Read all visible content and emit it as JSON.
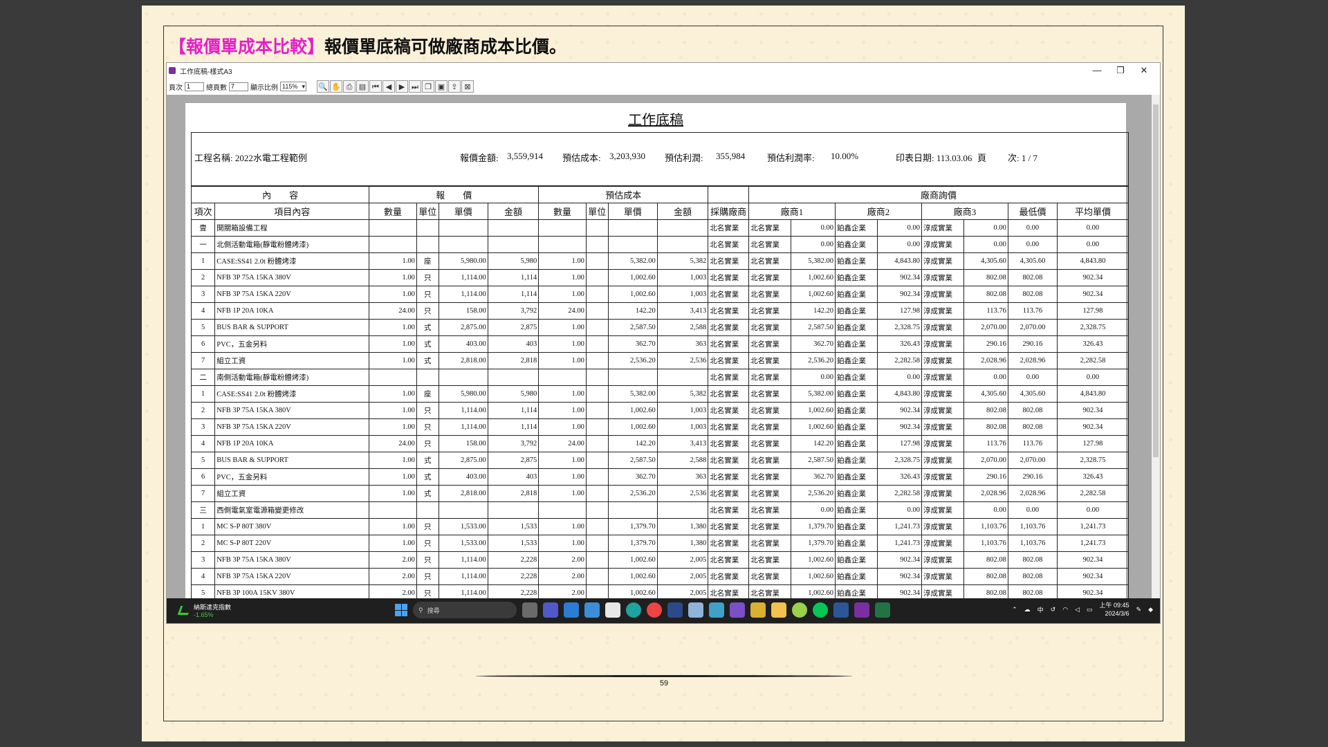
{
  "slide": {
    "heading_bracket": "【報價單成本比較】",
    "heading_text": "報價單底稿可做廠商成本比價。",
    "page_number": "59"
  },
  "window": {
    "title": "工作底稿-樣式A3",
    "minimize": "—",
    "restore": "❐",
    "close": "✕",
    "toolbar": {
      "page_label": "頁次",
      "page_value": "1",
      "total_label": "總頁數",
      "total_value": "7",
      "zoom_label": "顯示比例",
      "zoom_value": "115%"
    }
  },
  "report": {
    "title": "工作底稿",
    "project_name": "工程名稱: 2022水電工程範例",
    "quote_label": "報價金額:",
    "quote_value": "3,559,914",
    "cost_label": "預估成本:",
    "cost_value": "3,203,930",
    "profit_label": "預估利潤:",
    "profit_value": "355,984",
    "rate_label": "預估利潤率:",
    "rate_value": "10.00%",
    "print_date": "印表日期: 113.03.06",
    "page_label": "頁",
    "page_info": "次:  1  /  7",
    "group_headers": {
      "content": "內　　容",
      "quote": "報　　價",
      "cost": "預估成本",
      "vendor": "廠商詢價"
    },
    "columns": [
      "項次",
      "項目內容",
      "數量",
      "單位",
      "單價",
      "金額",
      "數量",
      "單位",
      "單價",
      "金額",
      "採購廠商",
      "廠商1",
      "廠商2",
      "廠商3",
      "最低價",
      "平均單價"
    ],
    "rows": [
      [
        "壹",
        "開關箱設備工程",
        "",
        "",
        "",
        "",
        "",
        "",
        "",
        "",
        "北名實業",
        "北名實業",
        "0.00",
        "鉑鑫企業",
        "0.00",
        "淳成實業",
        "0.00",
        "0.00",
        "0.00"
      ],
      [
        "一",
        "北側活動電箱(靜電粉體烤漆)",
        "",
        "",
        "",
        "",
        "",
        "",
        "",
        "",
        "北名實業",
        "北名實業",
        "0.00",
        "鉑鑫企業",
        "0.00",
        "淳成實業",
        "0.00",
        "0.00",
        "0.00"
      ],
      [
        "1",
        "CASE:SS41 2.0t 粉體烤漆",
        "1.00",
        "座",
        "5,980.00",
        "5,980",
        "1.00",
        "",
        "5,382.00",
        "5,382",
        "北名實業",
        "北名實業",
        "5,382.00",
        "鉑鑫企業",
        "4,843.80",
        "淳成實業",
        "4,305.60",
        "4,305.60",
        "4,843.80"
      ],
      [
        "2",
        "NFB 3P 75A 15KA 380V",
        "1.00",
        "只",
        "1,114.00",
        "1,114",
        "1.00",
        "",
        "1,002.60",
        "1,003",
        "北名實業",
        "北名實業",
        "1,002.60",
        "鉑鑫企業",
        "902.34",
        "淳成實業",
        "802.08",
        "802.08",
        "902.34"
      ],
      [
        "3",
        "NFB 3P 75A 15KA 220V",
        "1.00",
        "只",
        "1,114.00",
        "1,114",
        "1.00",
        "",
        "1,002.60",
        "1,003",
        "北名實業",
        "北名實業",
        "1,002.60",
        "鉑鑫企業",
        "902.34",
        "淳成實業",
        "802.08",
        "802.08",
        "902.34"
      ],
      [
        "4",
        "NFB 1P 20A 10KA",
        "24.00",
        "只",
        "158.00",
        "3,792",
        "24.00",
        "",
        "142.20",
        "3,413",
        "北名實業",
        "北名實業",
        "142.20",
        "鉑鑫企業",
        "127.98",
        "淳成實業",
        "113.76",
        "113.76",
        "127.98"
      ],
      [
        "5",
        "BUS BAR & SUPPORT",
        "1.00",
        "式",
        "2,875.00",
        "2,875",
        "1.00",
        "",
        "2,587.50",
        "2,588",
        "北名實業",
        "北名實業",
        "2,587.50",
        "鉑鑫企業",
        "2,328.75",
        "淳成實業",
        "2,070.00",
        "2,070.00",
        "2,328.75"
      ],
      [
        "6",
        "PVC，五金另料",
        "1.00",
        "式",
        "403.00",
        "403",
        "1.00",
        "",
        "362.70",
        "363",
        "北名實業",
        "北名實業",
        "362.70",
        "鉑鑫企業",
        "326.43",
        "淳成實業",
        "290.16",
        "290.16",
        "326.43"
      ],
      [
        "7",
        "組立工資",
        "1.00",
        "式",
        "2,818.00",
        "2,818",
        "1.00",
        "",
        "2,536.20",
        "2,536",
        "北名實業",
        "北名實業",
        "2,536.20",
        "鉑鑫企業",
        "2,282.58",
        "淳成實業",
        "2,028.96",
        "2,028.96",
        "2,282.58"
      ],
      [
        "二",
        "南側活動電箱(靜電粉體烤漆)",
        "",
        "",
        "",
        "",
        "",
        "",
        "",
        "",
        "北名實業",
        "北名實業",
        "0.00",
        "鉑鑫企業",
        "0.00",
        "淳成實業",
        "0.00",
        "0.00",
        "0.00"
      ],
      [
        "1",
        "CASE:SS41 2.0t 粉體烤漆",
        "1.00",
        "座",
        "5,980.00",
        "5,980",
        "1.00",
        "",
        "5,382.00",
        "5,382",
        "北名實業",
        "北名實業",
        "5,382.00",
        "鉑鑫企業",
        "4,843.80",
        "淳成實業",
        "4,305.60",
        "4,305.60",
        "4,843.80"
      ],
      [
        "2",
        "NFB 3P 75A 15KA 380V",
        "1.00",
        "只",
        "1,114.00",
        "1,114",
        "1.00",
        "",
        "1,002.60",
        "1,003",
        "北名實業",
        "北名實業",
        "1,002.60",
        "鉑鑫企業",
        "902.34",
        "淳成實業",
        "802.08",
        "802.08",
        "902.34"
      ],
      [
        "3",
        "NFB 3P 75A 15KA 220V",
        "1.00",
        "只",
        "1,114.00",
        "1,114",
        "1.00",
        "",
        "1,002.60",
        "1,003",
        "北名實業",
        "北名實業",
        "1,002.60",
        "鉑鑫企業",
        "902.34",
        "淳成實業",
        "802.08",
        "802.08",
        "902.34"
      ],
      [
        "4",
        "NFB 1P 20A 10KA",
        "24.00",
        "只",
        "158.00",
        "3,792",
        "24.00",
        "",
        "142.20",
        "3,413",
        "北名實業",
        "北名實業",
        "142.20",
        "鉑鑫企業",
        "127.98",
        "淳成實業",
        "113.76",
        "113.76",
        "127.98"
      ],
      [
        "5",
        "BUS BAR & SUPPORT",
        "1.00",
        "式",
        "2,875.00",
        "2,875",
        "1.00",
        "",
        "2,587.50",
        "2,588",
        "北名實業",
        "北名實業",
        "2,587.50",
        "鉑鑫企業",
        "2,328.75",
        "淳成實業",
        "2,070.00",
        "2,070.00",
        "2,328.75"
      ],
      [
        "6",
        "PVC，五金另料",
        "1.00",
        "式",
        "403.00",
        "403",
        "1.00",
        "",
        "362.70",
        "363",
        "北名實業",
        "北名實業",
        "362.70",
        "鉑鑫企業",
        "326.43",
        "淳成實業",
        "290.16",
        "290.16",
        "326.43"
      ],
      [
        "7",
        "組立工資",
        "1.00",
        "式",
        "2,818.00",
        "2,818",
        "1.00",
        "",
        "2,536.20",
        "2,536",
        "北名實業",
        "北名實業",
        "2,536.20",
        "鉑鑫企業",
        "2,282.58",
        "淳成實業",
        "2,028.96",
        "2,028.96",
        "2,282.58"
      ],
      [
        "三",
        "西側電氣室電源箱變更修改",
        "",
        "",
        "",
        "",
        "",
        "",
        "",
        "",
        "北名實業",
        "北名實業",
        "0.00",
        "鉑鑫企業",
        "0.00",
        "淳成實業",
        "0.00",
        "0.00",
        "0.00"
      ],
      [
        "1",
        "MC S-P 80T 380V",
        "1.00",
        "只",
        "1,533.00",
        "1,533",
        "1.00",
        "",
        "1,379.70",
        "1,380",
        "北名實業",
        "北名實業",
        "1,379.70",
        "鉑鑫企業",
        "1,241.73",
        "淳成實業",
        "1,103.76",
        "1,103.76",
        "1,241.73"
      ],
      [
        "2",
        "MC S-P 80T 220V",
        "1.00",
        "只",
        "1,533.00",
        "1,533",
        "1.00",
        "",
        "1,379.70",
        "1,380",
        "北名實業",
        "北名實業",
        "1,379.70",
        "鉑鑫企業",
        "1,241.73",
        "淳成實業",
        "1,103.76",
        "1,103.76",
        "1,241.73"
      ],
      [
        "3",
        "NFB 3P 75A 15KA 380V",
        "2.00",
        "只",
        "1,114.00",
        "2,228",
        "2.00",
        "",
        "1,002.60",
        "2,005",
        "北名實業",
        "北名實業",
        "1,002.60",
        "鉑鑫企業",
        "902.34",
        "淳成實業",
        "802.08",
        "802.08",
        "902.34"
      ],
      [
        "4",
        "NFB 3P 75A 15KA 220V",
        "2.00",
        "只",
        "1,114.00",
        "2,228",
        "2.00",
        "",
        "1,002.60",
        "2,005",
        "北名實業",
        "北名實業",
        "1,002.60",
        "鉑鑫企業",
        "902.34",
        "淳成實業",
        "802.08",
        "802.08",
        "902.34"
      ],
      [
        "5",
        "NFB 3P 100A 15KV 380V",
        "2.00",
        "只",
        "1,114.00",
        "2,228",
        "2.00",
        "",
        "1,002.60",
        "2,005",
        "北名實業",
        "北名實業",
        "1,002.60",
        "鉑鑫企業",
        "902.34",
        "淳成實業",
        "802.08",
        "802.08",
        "902.34"
      ]
    ]
  },
  "taskbar": {
    "stock_name": "納斯達克指數",
    "stock_change": "-1.65%",
    "search_placeholder": "搜尋",
    "lang": "中",
    "time": "上午 09:45",
    "date": "2024/3/6"
  },
  "colors": {
    "heading_accent": "#e61fc8",
    "paper": "#fbf1d8",
    "taskbar": "#1f1f1f"
  }
}
